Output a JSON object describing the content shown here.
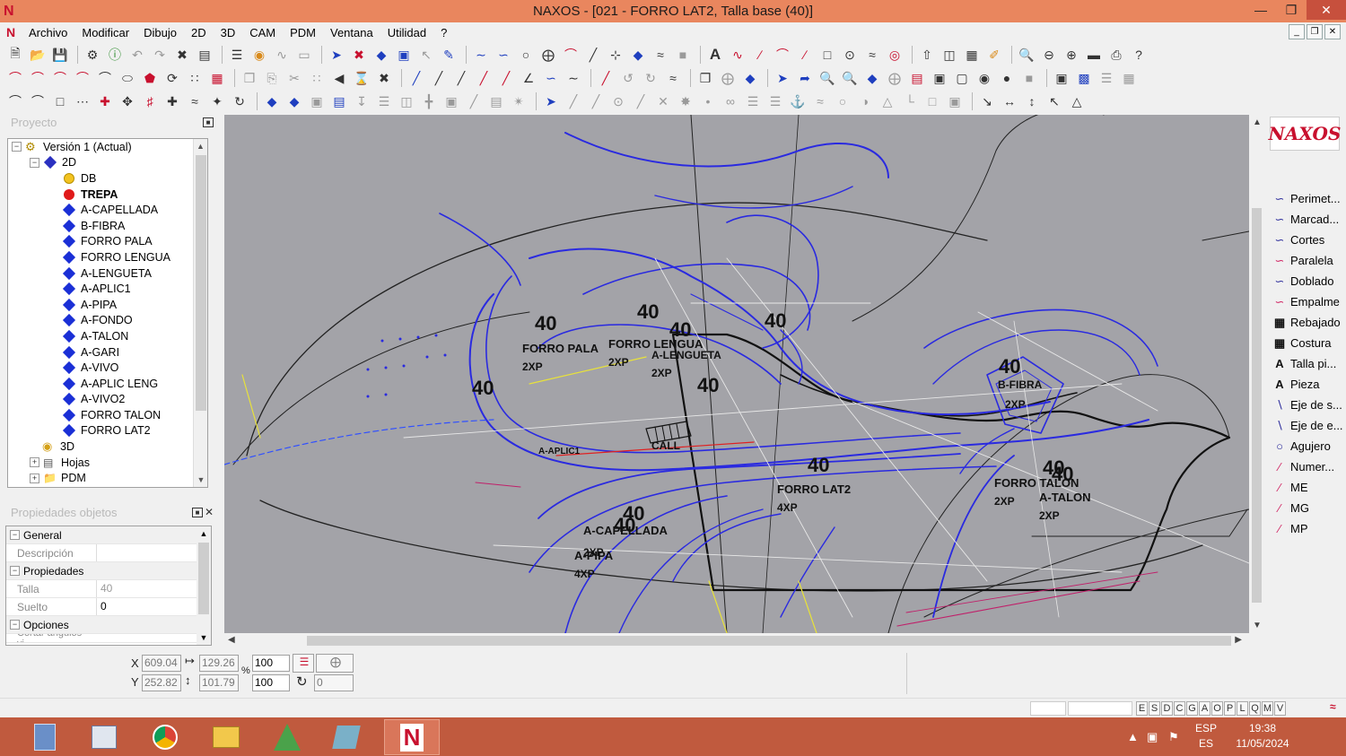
{
  "window": {
    "title": "NAXOS - [021 - FORRO LAT2, Talla base (40)]",
    "logo_glyph": "N"
  },
  "menu": [
    "Archivo",
    "Modificar",
    "Dibujo",
    "2D",
    "3D",
    "CAM",
    "PDM",
    "Ventana",
    "Utilidad",
    "?"
  ],
  "project_panel": {
    "title": "Proyecto",
    "tree": {
      "root": "Versión 1 (Actual)",
      "node_2d": "2D",
      "layers": [
        {
          "label": "DB",
          "kind": "yellow"
        },
        {
          "label": "TREPA",
          "kind": "red",
          "bold": true
        },
        {
          "label": "A-CAPELLADA",
          "kind": "diamond"
        },
        {
          "label": "B-FIBRA",
          "kind": "diamond"
        },
        {
          "label": "FORRO PALA",
          "kind": "diamond"
        },
        {
          "label": "FORRO LENGUA",
          "kind": "diamond"
        },
        {
          "label": "A-LENGUETA",
          "kind": "diamond"
        },
        {
          "label": "A-APLIC1",
          "kind": "diamond"
        },
        {
          "label": "A-PIPA",
          "kind": "diamond"
        },
        {
          "label": "A-FONDO",
          "kind": "diamond"
        },
        {
          "label": "A-TALON",
          "kind": "diamond"
        },
        {
          "label": "A-GARI",
          "kind": "diamond"
        },
        {
          "label": "A-VIVO",
          "kind": "diamond"
        },
        {
          "label": "A-APLIC LENG",
          "kind": "diamond"
        },
        {
          "label": "A-VIVO2",
          "kind": "diamond"
        },
        {
          "label": "FORRO TALON",
          "kind": "diamond"
        },
        {
          "label": "FORRO LAT2",
          "kind": "diamond"
        }
      ],
      "node_3d": "3D",
      "node_hojas": "Hojas",
      "node_pdm": "PDM"
    }
  },
  "properties_panel": {
    "title": "Propiedades objetos",
    "sections": {
      "general": "General",
      "descripcion_label": "Descripción",
      "descripcion_value": "",
      "propiedades": "Propiedades",
      "talla_label": "Talla",
      "talla_value": "40",
      "suelto_label": "Suelto",
      "suelto_value": "0",
      "opciones": "Opciones",
      "cut_row": "Cortar ángulos vi..."
    }
  },
  "canvas": {
    "background": "#a3a3a8",
    "labels": [
      "40",
      "FORRO PALA",
      "2XP",
      "40",
      "FORRO LENGUA",
      "2XP",
      "40",
      "A-LENGUETA",
      "2XP",
      "40",
      "40",
      "40",
      "B-FIBRA",
      "2XP",
      "40",
      "FORRO LAT2",
      "4XP",
      "40",
      "FORRO TALON",
      "2XP",
      "40",
      "A-TALON",
      "2XP",
      "40",
      "A-CAPELLADA",
      "2XP",
      "40",
      "A-PIPA",
      "4XP",
      "A-APLIC1",
      "CALL",
      "40"
    ]
  },
  "right_panel": {
    "logo_text": "NAXOS",
    "items": [
      "Perimet...",
      "Marcad...",
      "Cortes",
      "Paralela",
      "Doblado",
      "Empalme",
      "Rebajado",
      "Costura",
      "Talla pi...",
      "Pieza",
      "Eje de s...",
      "Eje de e...",
      "Agujero",
      "Numer...",
      "ME",
      "MG",
      "MP"
    ]
  },
  "coords": {
    "x_label": "X",
    "y_label": "Y",
    "x_value": "609.04",
    "y_value": "252.82",
    "width_value": "129.26",
    "height_value": "101.79",
    "scale_x": "100",
    "scale_y": "100",
    "percent": "%",
    "angle": "0"
  },
  "statusbar": {
    "letters": [
      "E",
      "S",
      "D",
      "C",
      "G",
      "A",
      "O",
      "P",
      "L",
      "Q",
      "M",
      "V"
    ]
  },
  "taskbar": {
    "lang_top": "ESP",
    "lang_bottom": "ES",
    "time": "19:38",
    "date": "11/05/2024"
  }
}
